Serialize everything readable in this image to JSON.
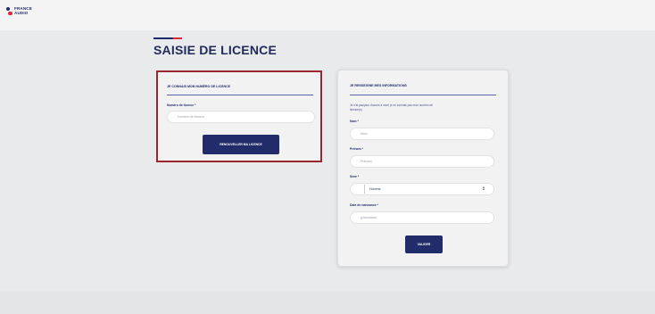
{
  "brand": {
    "logo_line1": "FRANCE",
    "logo_line2": "AUDIO"
  },
  "page": {
    "title": "SAISIE DE LICENCE"
  },
  "license_form": {
    "heading": "JE CONNAIS MON NUMÉRO DE LICENCE",
    "license_label": "Numéro de licence *",
    "license_placeholder": "Numéro de licence",
    "submit_label": "RENOUVELLER MA LICENCE"
  },
  "info_form": {
    "heading": "JE RENSEIGNE MES INFORMATIONS",
    "helper_line1": "Je n'ai pas/plus d'accès à mon/ je ne connais pas mon numéro de",
    "helper_line2": "licence(s)",
    "last_name_label": "Nom *",
    "last_name_placeholder": "Nom",
    "first_name_label": "Prénom *",
    "first_name_placeholder": "Prénom",
    "sex_label": "Sexe *",
    "sex_value": "Homme",
    "birth_label": "Date de naissance *",
    "birth_placeholder": "jj/mm/aaaa",
    "submit_label": "VALIDER"
  },
  "colors": {
    "brand_blue": "#1f2a6e",
    "brand_red": "#e3262f",
    "highlight_border": "#9a2630",
    "button_bg": "#232c6a"
  }
}
